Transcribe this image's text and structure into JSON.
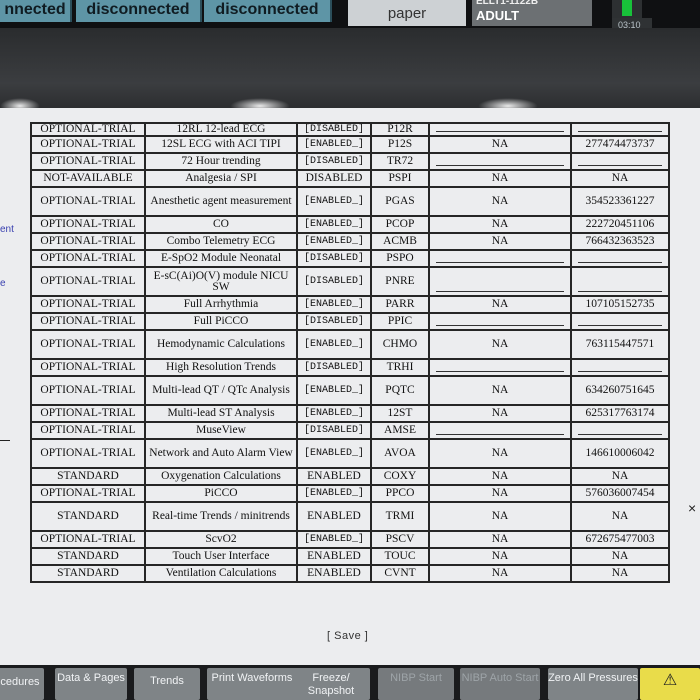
{
  "topbar": {
    "status_buttons": [
      "nnected",
      "disconnected",
      "disconnected"
    ],
    "paper_label": "paper",
    "patient_bed": "ELLT1-1122B",
    "patient_type": "ADULT",
    "clock": "03:10"
  },
  "side_labels": [
    "ent",
    "e"
  ],
  "options_table": {
    "rows": [
      {
        "type": "OPTIONAL-TRIAL",
        "name": "12RL 12-lead ECG",
        "status": "[DISABLED]",
        "code": "P12R",
        "expires": "",
        "key": ""
      },
      {
        "type": "OPTIONAL-TRIAL",
        "name": "12SL ECG with ACI TIPI",
        "status": "[ENABLED_]",
        "code": "P12S",
        "expires": "NA",
        "key": "277474473737"
      },
      {
        "type": "OPTIONAL-TRIAL",
        "name": "72 Hour trending",
        "status": "[DISABLED]",
        "code": "TR72",
        "expires": "",
        "key": ""
      },
      {
        "type": "NOT-AVAILABLE",
        "name": "Analgesia / SPI",
        "status": "DISABLED",
        "code": "PSPI",
        "expires": "NA",
        "key": "NA"
      },
      {
        "type": "OPTIONAL-TRIAL",
        "name": "Anesthetic agent measurement",
        "status": "[ENABLED_]",
        "code": "PGAS",
        "expires": "NA",
        "key": "354523361227"
      },
      {
        "type": "OPTIONAL-TRIAL",
        "name": "CO",
        "status": "[ENABLED_]",
        "code": "PCOP",
        "expires": "NA",
        "key": "222720451106"
      },
      {
        "type": "OPTIONAL-TRIAL",
        "name": "Combo Telemetry ECG",
        "status": "[ENABLED_]",
        "code": "ACMB",
        "expires": "NA",
        "key": "766432363523"
      },
      {
        "type": "OPTIONAL-TRIAL",
        "name": "E-SpO2 Module Neonatal",
        "status": "[DISABLED]",
        "code": "PSPO",
        "expires": "",
        "key": ""
      },
      {
        "type": "OPTIONAL-TRIAL",
        "name": "E-sC(Ai)O(V) module NICU SW",
        "status": "[DISABLED]",
        "code": "PNRE",
        "expires": "",
        "key": ""
      },
      {
        "type": "OPTIONAL-TRIAL",
        "name": "Full Arrhythmia",
        "status": "[ENABLED_]",
        "code": "PARR",
        "expires": "NA",
        "key": "107105152735"
      },
      {
        "type": "OPTIONAL-TRIAL",
        "name": "Full PiCCO",
        "status": "[DISABLED]",
        "code": "PPIC",
        "expires": "",
        "key": ""
      },
      {
        "type": "OPTIONAL-TRIAL",
        "name": "Hemodynamic Calculations",
        "status": "[ENABLED_]",
        "code": "CHMO",
        "expires": "NA",
        "key": "763115447571"
      },
      {
        "type": "OPTIONAL-TRIAL",
        "name": "High Resolution Trends",
        "status": "[DISABLED]",
        "code": "TRHI",
        "expires": "",
        "key": ""
      },
      {
        "type": "OPTIONAL-TRIAL",
        "name": "Multi-lead QT / QTc Analysis",
        "status": "[ENABLED_]",
        "code": "PQTC",
        "expires": "NA",
        "key": "634260751645"
      },
      {
        "type": "OPTIONAL-TRIAL",
        "name": "Multi-lead ST Analysis",
        "status": "[ENABLED_]",
        "code": "12ST",
        "expires": "NA",
        "key": "625317763174"
      },
      {
        "type": "OPTIONAL-TRIAL",
        "name": "MuseView",
        "status": "[DISABLED]",
        "code": "AMSE",
        "expires": "",
        "key": ""
      },
      {
        "type": "OPTIONAL-TRIAL",
        "name": "Network and Auto Alarm View",
        "status": "[ENABLED_]",
        "code": "AVOA",
        "expires": "NA",
        "key": "146610006042"
      },
      {
        "type": "STANDARD",
        "name": "Oxygenation Calculations",
        "status": "ENABLED",
        "code": "COXY",
        "expires": "NA",
        "key": "NA"
      },
      {
        "type": "OPTIONAL-TRIAL",
        "name": "PiCCO",
        "status": "[ENABLED_]",
        "code": "PPCO",
        "expires": "NA",
        "key": "576036007454"
      },
      {
        "type": "STANDARD",
        "name": "Real-time Trends / minitrends",
        "status": "ENABLED",
        "code": "TRMI",
        "expires": "NA",
        "key": "NA"
      },
      {
        "type": "OPTIONAL-TRIAL",
        "name": "ScvO2",
        "status": "[ENABLED_]",
        "code": "PSCV",
        "expires": "NA",
        "key": "672675477003"
      },
      {
        "type": "STANDARD",
        "name": "Touch User Interface",
        "status": "ENABLED",
        "code": "TOUC",
        "expires": "NA",
        "key": "NA"
      },
      {
        "type": "STANDARD",
        "name": "Ventilation Calculations",
        "status": "ENABLED",
        "code": "CVNT",
        "expires": "NA",
        "key": "NA"
      }
    ]
  },
  "save_label": "[ Save ]",
  "side_close": "×",
  "softkeys": [
    {
      "label": "cedures",
      "dim": false
    },
    {
      "label": "Data & Pages",
      "dim": false
    },
    {
      "label": "Trends",
      "dim": false
    },
    {
      "label": "Print Waveforms",
      "dim": false
    },
    {
      "label": "Freeze/ Snapshot",
      "dim": false
    },
    {
      "label": "NIBP Start",
      "dim": true
    },
    {
      "label": "NIBP Auto Start",
      "dim": true
    },
    {
      "label": "Zero All Pressures",
      "dim": false
    },
    {
      "label": "⚠",
      "dim": false
    }
  ]
}
